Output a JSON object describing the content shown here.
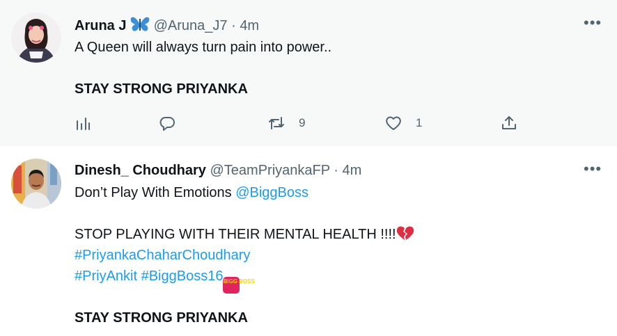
{
  "tweets": [
    {
      "name": "Aruna J",
      "badge_icon": "butterfly-icon",
      "handle": "@Aruna_J7",
      "separator": "·",
      "time": "4m",
      "text_line1": "A Queen will always turn pain into power..",
      "text_line2": "STAY STRONG PRIYANKA",
      "actions": {
        "views_icon": "views-icon",
        "reply_icon": "reply-icon",
        "retweet_icon": "retweet-icon",
        "retweet_count": "9",
        "like_icon": "heart-icon",
        "like_count": "1",
        "share_icon": "share-icon"
      }
    },
    {
      "name": "Dinesh_ Choudhary",
      "handle": "@TeamPriyankaFP",
      "separator": "·",
      "time": "4m",
      "line1_text": "Don’t Play With Emotions ",
      "line1_mention": "@BiggBoss",
      "line2_text": "STOP PLAYING WITH THEIR MENTAL HEALTH !!!!",
      "line2_emoji": "broken-heart-emoji",
      "hashtag1": "#PriyankaChaharChoudhary",
      "hashtag2": "#PriyAnkit",
      "hashtag3": "#BiggBoss16",
      "hashtag_emoji_text": "BIGG BOSS",
      "line_last": "STAY STRONG PRIYANKA"
    }
  ],
  "colors": {
    "accent": "#1d9bf0",
    "muted": "#536471",
    "text": "#0f1419",
    "hover_bg": "#f7f9f9"
  }
}
